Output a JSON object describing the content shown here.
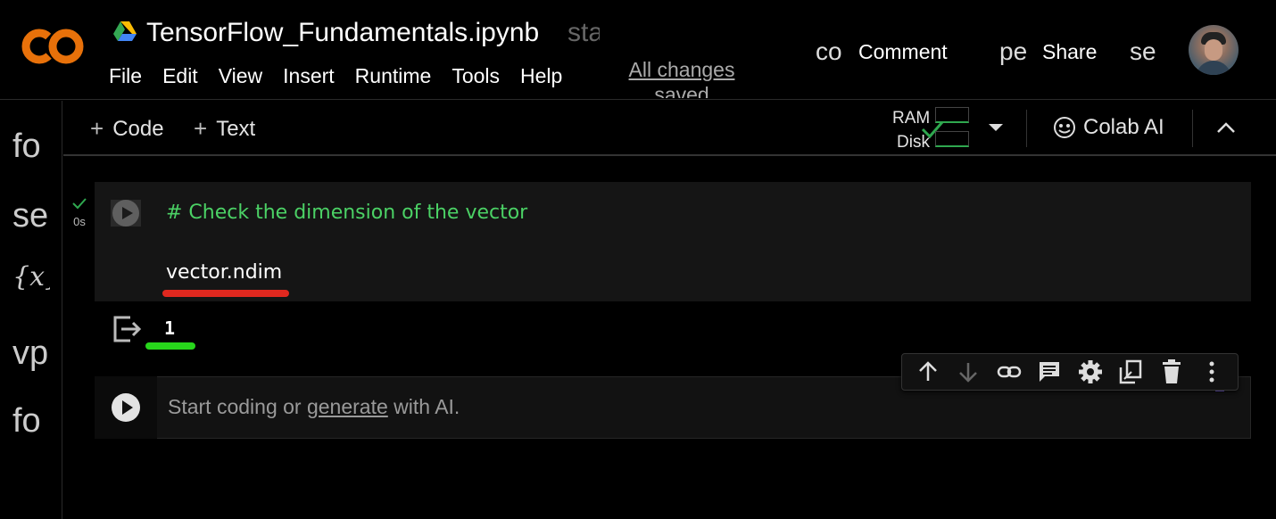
{
  "header": {
    "logo_text": "CO",
    "notebook_title": "TensorFlow_Fundamentals.ipynb",
    "title_clipped": "star",
    "menu": [
      "File",
      "Edit",
      "View",
      "Insert",
      "Runtime",
      "Tools",
      "Help"
    ],
    "save_status": "All changes saved",
    "comment_glyph": "co",
    "comment_label": "Comment",
    "share_glyph": "pe",
    "share_label": "Share",
    "settings_glyph": "se"
  },
  "sidebar": {
    "items": [
      "fo",
      "se",
      "{x}",
      "vp",
      "fo"
    ]
  },
  "toolbar": {
    "add_code": "Code",
    "add_text": "Text",
    "ram_label": "RAM",
    "disk_label": "Disk",
    "colab_ai_label": "Colab AI"
  },
  "cell": {
    "exec_time": "0s",
    "comment_line": "# Check the dimension of the vector",
    "code_line": "vector.ndim",
    "output": "1"
  },
  "empty_cell": {
    "placeholder_prefix": "Start coding or ",
    "placeholder_link": "generate",
    "placeholder_suffix": " with AI."
  },
  "colors": {
    "logo_orange": "#e8710a",
    "comment_green": "#4bd165",
    "red_annotation": "#e0281f",
    "green_annotation": "#27d51b",
    "running_check": "#2fa84f"
  }
}
